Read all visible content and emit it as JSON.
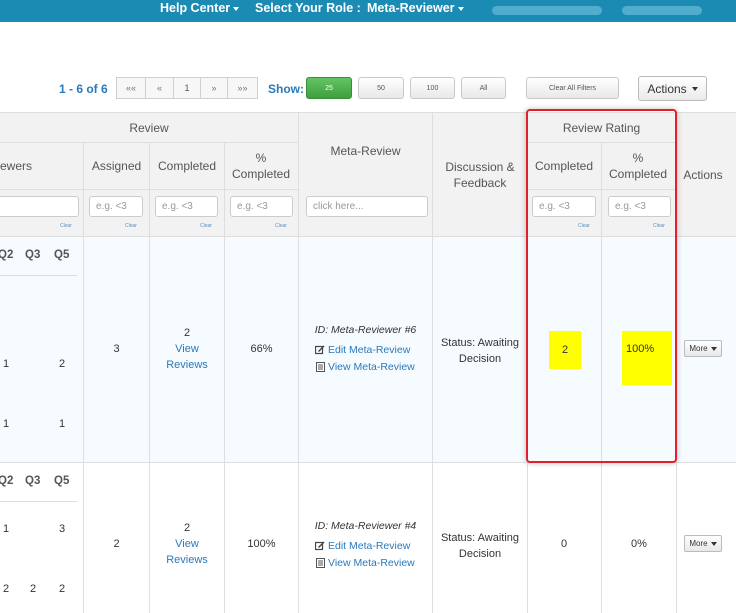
{
  "topbar": {
    "help_center": "Help Center",
    "role_label": "Select Your Role :",
    "role_value": "Meta-Reviewer"
  },
  "pager": {
    "range": "1 - 6 of 6",
    "first": "««",
    "prev": "«",
    "current": "1",
    "next": "»",
    "last": "»»"
  },
  "show": {
    "label": "Show:",
    "options": [
      "25",
      "50",
      "100",
      "All"
    ],
    "clear_filters": "Clear All Filters"
  },
  "actions_label": "Actions",
  "columns": {
    "reviewers_partial": "ewers",
    "review_group": "Review",
    "assigned": "Assigned",
    "completed": "Completed",
    "pct_completed": "% Completed",
    "meta_review": "Meta-Review",
    "discussion": "Discussion & Feedback",
    "rating_group": "Review Rating",
    "rating_completed": "Completed",
    "rating_pct": "% Completed",
    "actions": "Actions"
  },
  "filters": {
    "eg_placeholder": "e.g. <3",
    "click_placeholder": "click here...",
    "clear": "Clear"
  },
  "q_headers": [
    "Q2",
    "Q3",
    "Q5"
  ],
  "rows": [
    {
      "q_top": [
        "1",
        "",
        "2"
      ],
      "q_bottom": [
        "1",
        "",
        "1"
      ],
      "assigned": "3",
      "completed": "2",
      "view_reviews": "View Reviews",
      "pct": "66%",
      "meta_id": "ID: Meta-Reviewer #6",
      "edit_link": "Edit Meta-Review",
      "view_link": "View Meta-Review",
      "status": "Status: Awaiting Decision",
      "rating_completed": "2",
      "rating_pct": "100%",
      "more": "More"
    },
    {
      "q_top": [
        "1",
        "",
        "3"
      ],
      "q_bottom": [
        "2",
        "2",
        "2"
      ],
      "assigned": "2",
      "completed": "2",
      "view_reviews": "View Reviews",
      "pct": "100%",
      "meta_id": "ID: Meta-Reviewer #4",
      "edit_link": "Edit Meta-Review",
      "view_link": "View Meta-Review",
      "status": "Status: Awaiting Decision",
      "rating_completed": "0",
      "rating_pct": "0%",
      "more": "More"
    }
  ],
  "colors": {
    "topbar": "#1b8bb4",
    "link": "#2a79b9",
    "highlight": "#ffff00",
    "callout": "#e0202a",
    "active_show": "#4cae4c"
  }
}
